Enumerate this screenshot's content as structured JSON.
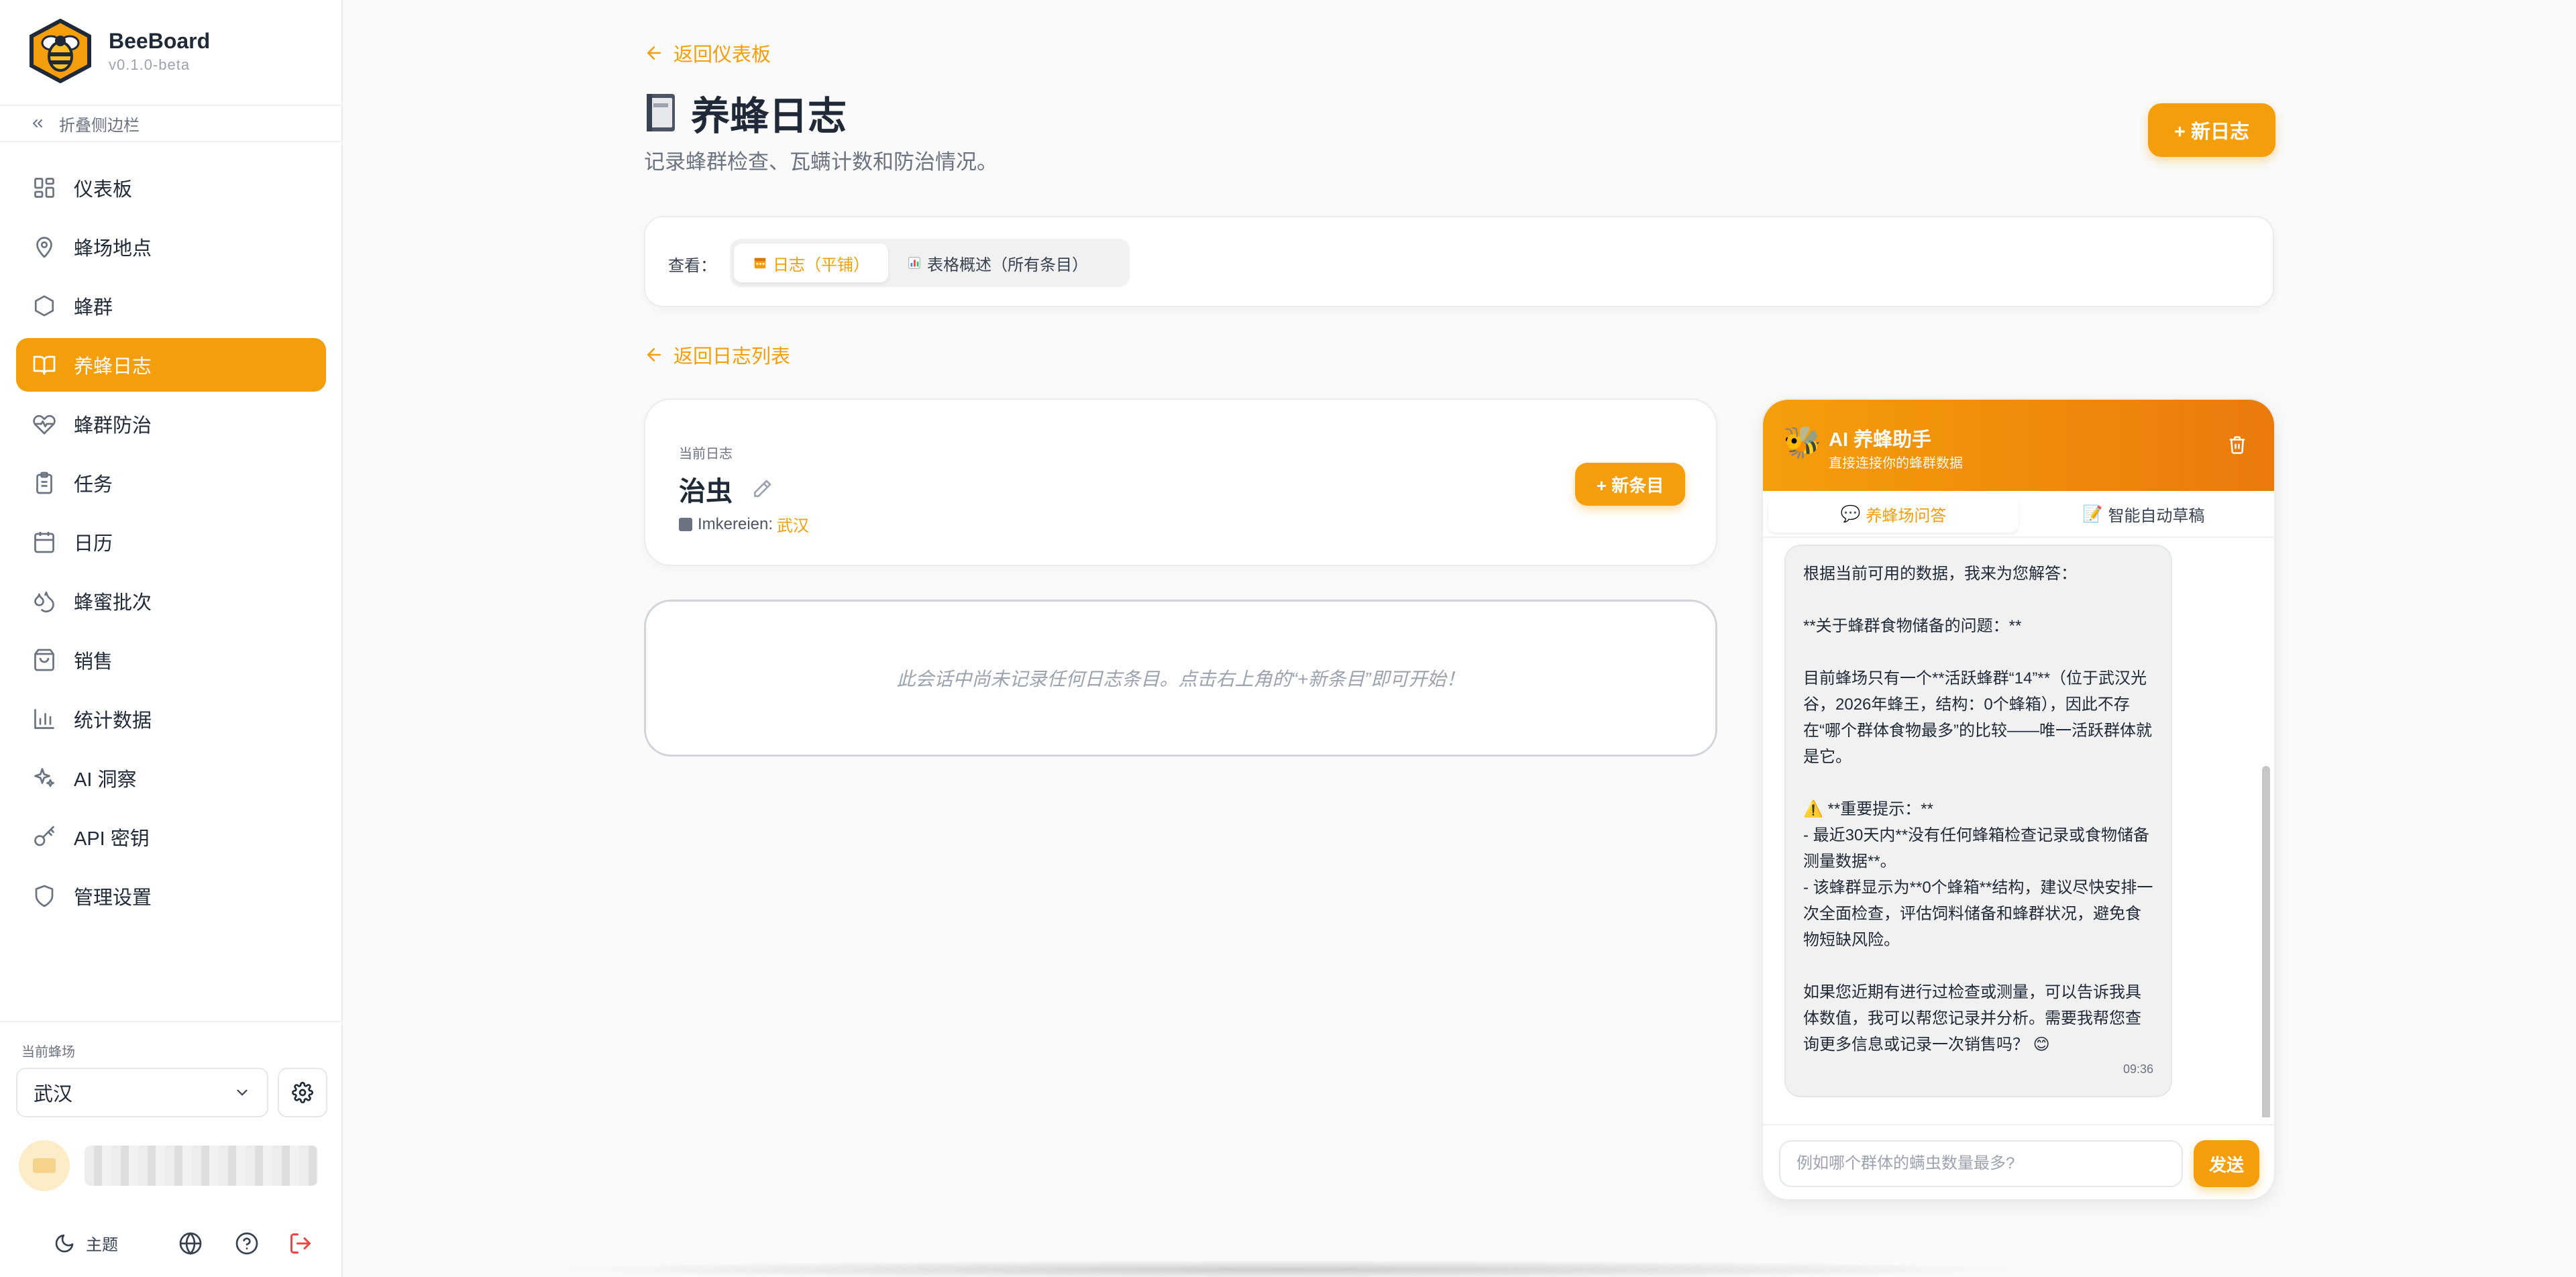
{
  "app": {
    "name": "BeeBoard",
    "version": "v0.1.0-beta",
    "collapse_label": "折叠侧边栏"
  },
  "sidebar": {
    "items": [
      {
        "label": "仪表板",
        "icon": "dashboard-icon"
      },
      {
        "label": "蜂场地点",
        "icon": "map-pin-icon"
      },
      {
        "label": "蜂群",
        "icon": "hexagon-icon"
      },
      {
        "label": "养蜂日志",
        "icon": "book-open-icon",
        "active": true
      },
      {
        "label": "蜂群防治",
        "icon": "heart-pulse-icon"
      },
      {
        "label": "任务",
        "icon": "clipboard-icon"
      },
      {
        "label": "日历",
        "icon": "calendar-icon"
      },
      {
        "label": "蜂蜜批次",
        "icon": "droplets-icon"
      },
      {
        "label": "销售",
        "icon": "shopping-bag-icon"
      },
      {
        "label": "统计数据",
        "icon": "bar-chart-icon"
      },
      {
        "label": "AI 洞察",
        "icon": "sparkles-icon"
      },
      {
        "label": "API 密钥",
        "icon": "key-icon"
      },
      {
        "label": "管理设置",
        "icon": "shield-icon"
      }
    ],
    "current_apiary_label": "当前蜂场",
    "current_apiary_value": "武汉",
    "theme_label": "主题"
  },
  "main": {
    "back_dashboard": "返回仪表板",
    "title": "养蜂日志",
    "subtitle": "记录蜂群检查、瓦螨计数和防治情况。",
    "new_log_button": "+ 新日志",
    "view_label": "查看：",
    "view_tabs": [
      {
        "label": "日志（平铺）",
        "active": true
      },
      {
        "label": "表格概述（所有条目）",
        "active": false
      }
    ],
    "back_list": "返回日志列表",
    "log": {
      "current_label": "当前日志",
      "name": "治虫",
      "meta_label": "Imkereien:",
      "meta_value": "武汉",
      "new_entry_button": "+ 新条目"
    },
    "empty_message": "此会话中尚未记录任何日志条目。点击右上角的“+新条目”即可开始！"
  },
  "ai": {
    "title": "AI 养蜂助手",
    "subtitle": "直接连接你的蜂群数据",
    "tabs": [
      {
        "label": "养蜂场问答",
        "active": true
      },
      {
        "label": "智能自动草稿",
        "active": false
      }
    ],
    "message": {
      "lines": [
        "根据当前可用的数据，我来为您解答：",
        "",
        "**关于蜂群食物储备的问题：**",
        "",
        "目前蜂场只有一个**活跃蜂群“14”**（位于武汉光谷，2026年蜂王，结构：0个蜂箱），因此不存在“哪个群体食物最多”的比较——唯一活跃群体就是它。",
        "",
        "⚠️ **重要提示：**",
        "- 最近30天内**没有任何蜂箱检查记录或食物储备测量数据**。",
        "- 该蜂群显示为**0个蜂箱**结构，建议尽快安排一次全面检查，评估饲料储备和蜂群状况，避免食物短缺风险。",
        "",
        "如果您近期有进行过检查或测量，可以告诉我具体数值，我可以帮您记录并分析。需要我帮您查询更多信息或记录一次销售吗？ 😊"
      ],
      "time": "09:36"
    },
    "input_placeholder": "例如哪个群体的螨虫数量最多?",
    "send_button": "发送"
  },
  "colors": {
    "accent": "#f59e0b",
    "accent_dark": "#ea7a0c",
    "logout": "#ef4444"
  }
}
